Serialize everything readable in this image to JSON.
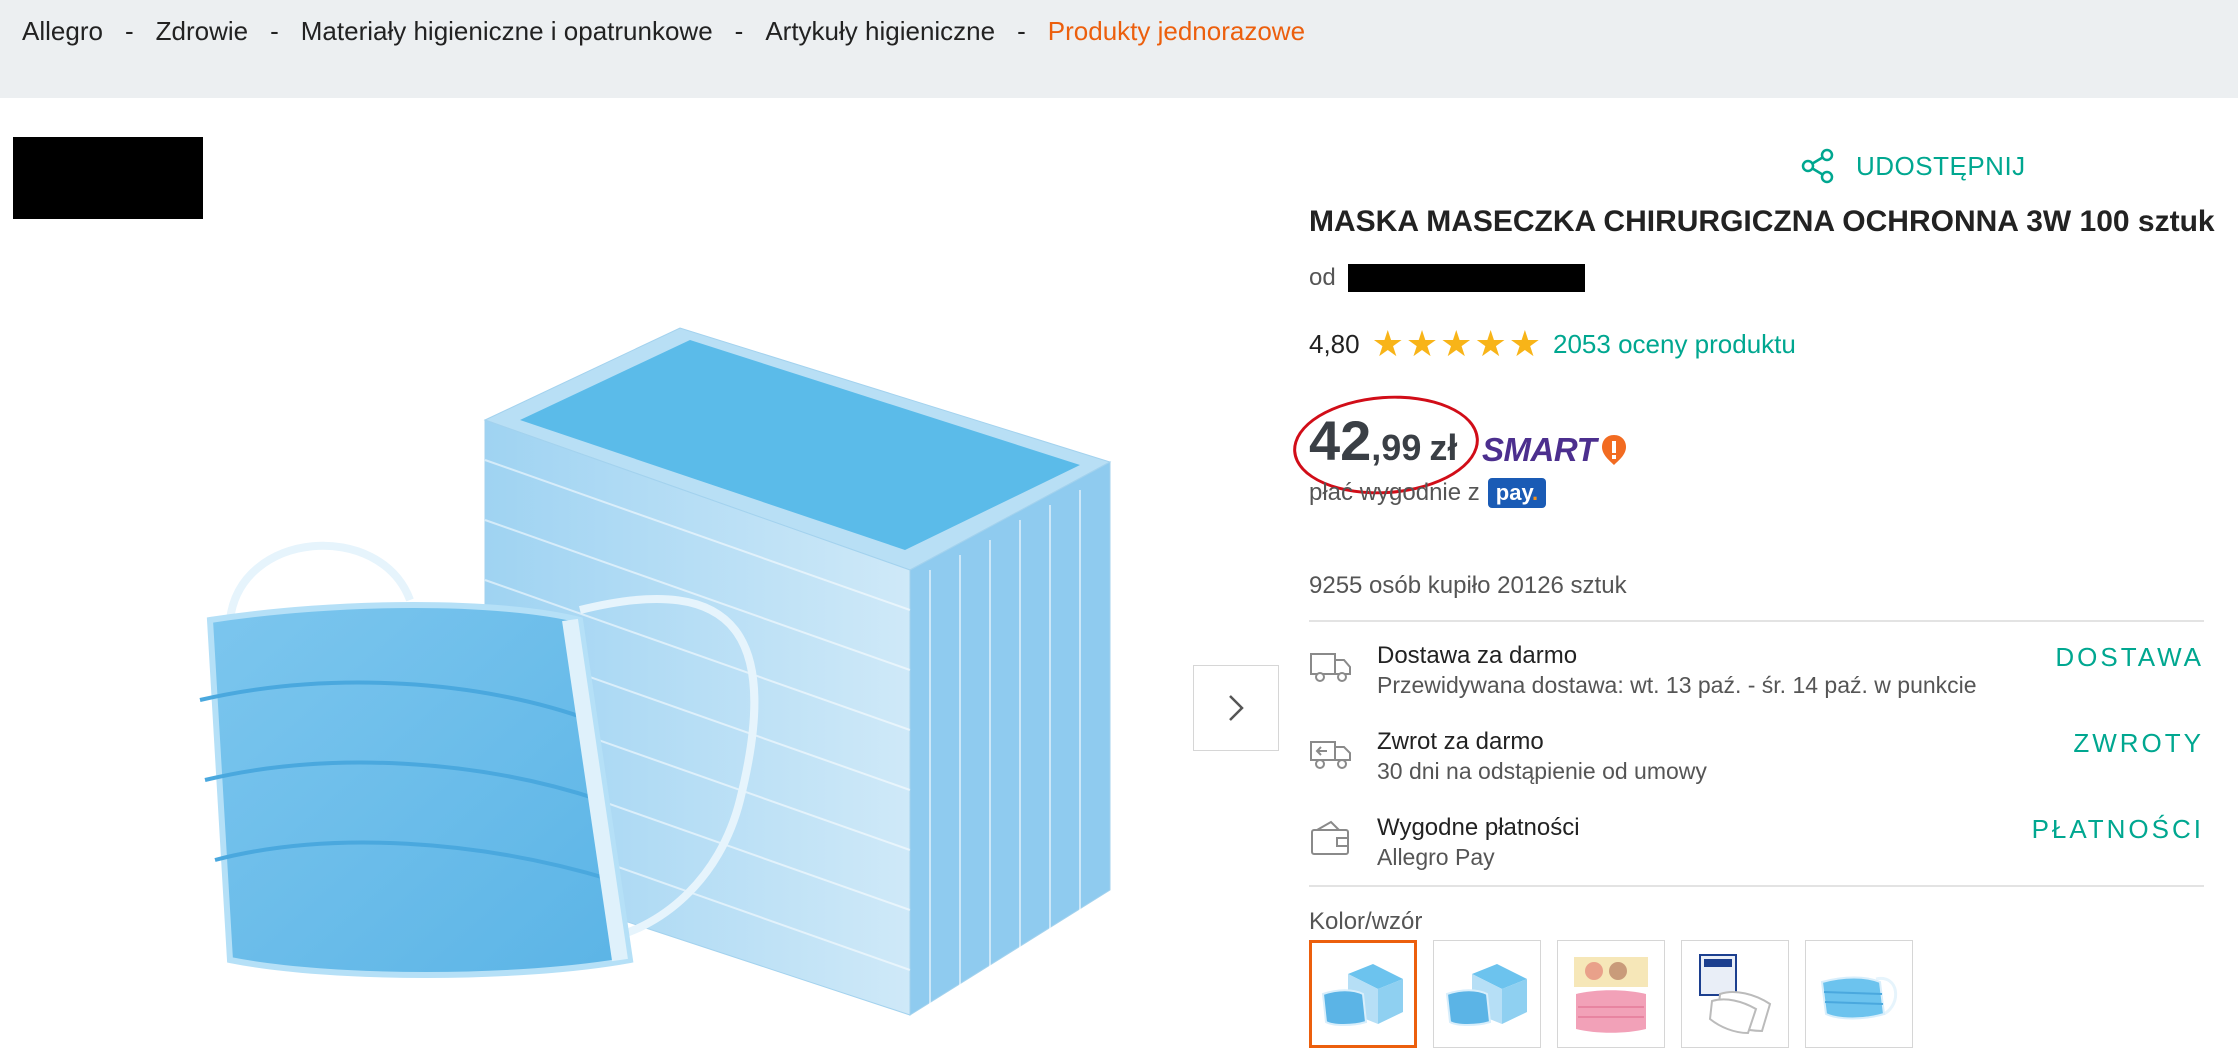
{
  "breadcrumb": {
    "items": [
      "Allegro",
      "Zdrowie",
      "Materiały higieniczne i opatrunkowe",
      "Artykuły higieniczne"
    ],
    "current": "Produkty jednorazowe",
    "separator": "-"
  },
  "product": {
    "title": "MASKA MASECZKA CHIRURGICZNA OCHRONNA 3W 100 sztuk",
    "seller_prefix": "od",
    "rating_value": "4,80",
    "rating_stars": 5,
    "rating_count_text": "2053 oceny produktu",
    "price_int": "42",
    "price_dec": ",99",
    "price_currency": "zł",
    "smart_label": "SMART",
    "pay_text": "płać wygodnie z",
    "pay_badge": "pay",
    "sold_text": "9255 osób kupiło 20126 sztuk"
  },
  "share_label": "UDOSTĘPNIJ",
  "info": [
    {
      "icon": "truck-icon",
      "main": "Dostawa za darmo",
      "sub": "Przewidywana dostawa: wt. 13 paź. - śr. 14 paź. w punkcie",
      "link": "DOSTAWA"
    },
    {
      "icon": "return-icon",
      "main": "Zwrot za darmo",
      "sub": "30 dni na odstąpienie od umowy",
      "link": "ZWROTY"
    },
    {
      "icon": "wallet-icon",
      "main": "Wygodne płatności",
      "sub": "Allegro Pay",
      "link": "PŁATNOŚCI"
    }
  ],
  "variant_label": "Kolor/wzór",
  "colors": {
    "accent": "#00a790",
    "breadcrumb_current": "#ec5f0d",
    "star": "#f8b418",
    "smart": "#4c2f8e",
    "circle": "#d10d18"
  }
}
